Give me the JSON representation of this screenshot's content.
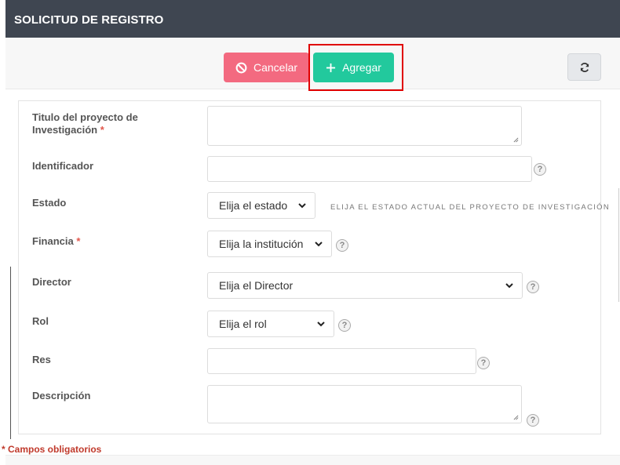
{
  "header": {
    "title": "SOLICITUD DE REGISTRO"
  },
  "toolbar": {
    "cancel_label": "Cancelar",
    "add_label": "Agregar"
  },
  "form": {
    "titulo": {
      "label": "Titulo del proyecto de Investigación",
      "required_mark": "*"
    },
    "identificador": {
      "label": "Identificador"
    },
    "estado": {
      "label": "Estado",
      "selected": "Elija el estado",
      "hint": "ELIJA EL ESTADO ACTUAL DEL PROYECTO DE INVESTIGACIÓN"
    },
    "financia": {
      "label": "Financia",
      "required_mark": "*",
      "selected": "Elija la institución"
    },
    "director": {
      "label": "Director",
      "selected": "Elija el Director"
    },
    "rol": {
      "label": "Rol",
      "selected": "Elija el rol"
    },
    "res": {
      "label": "Res"
    },
    "descripcion": {
      "label": "Descripción"
    }
  },
  "help_glyph": "?",
  "footer": {
    "required_note": "* Campos obligatorios"
  },
  "colors": {
    "header_bg": "#3f4651",
    "cancel_button": "#f36a80",
    "add_button": "#22c99d",
    "highlight_box": "#e00000",
    "required": "#e2574c"
  }
}
